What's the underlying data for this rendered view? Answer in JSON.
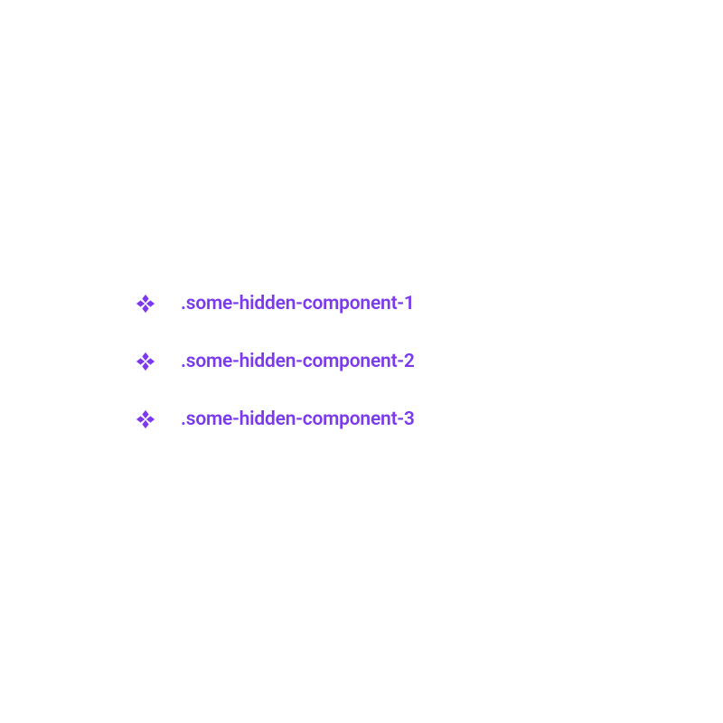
{
  "accent_color": "#7c3aed",
  "components": {
    "items": [
      {
        "label": ".some-hidden-component-1"
      },
      {
        "label": ".some-hidden-component-2"
      },
      {
        "label": ".some-hidden-component-3"
      }
    ]
  }
}
